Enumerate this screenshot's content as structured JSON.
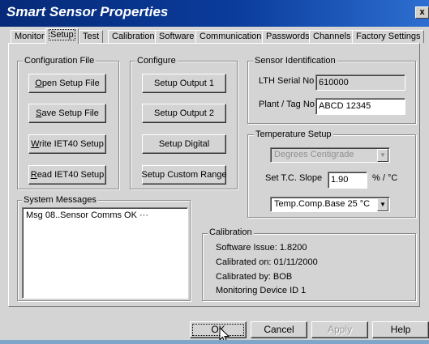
{
  "window": {
    "title": "Smart Sensor Properties",
    "close_glyph": "x"
  },
  "tabs": [
    {
      "label": "Monitor"
    },
    {
      "label": "Setup",
      "active": true
    },
    {
      "label": "Test"
    },
    {
      "label": "Calibration"
    },
    {
      "label": "Software"
    },
    {
      "label": "Communications"
    },
    {
      "label": "Passwords"
    },
    {
      "label": "Channels"
    },
    {
      "label": "Factory Settings"
    }
  ],
  "configuration_file": {
    "legend": "Configuration File",
    "open": "Open Setup File",
    "save": "Save Setup File",
    "write": "Write IET40 Setup",
    "read": "Read IET40 Setup"
  },
  "configure": {
    "legend": "Configure",
    "output1": "Setup Output 1",
    "output2": "Setup Output 2",
    "digital": "Setup Digital",
    "custom_range": "Setup Custom Range"
  },
  "sensor_identification": {
    "legend": "Sensor Identification",
    "serial_label": "LTH Serial No",
    "serial_value": "610000",
    "tag_label": "Plant / Tag No",
    "tag_value": "ABCD 12345"
  },
  "temperature_setup": {
    "legend": "Temperature Setup",
    "units_value": "Degrees Centigrade",
    "slope_label": "Set T.C. Slope",
    "slope_value": "1.90",
    "slope_unit": "% / °C",
    "comp_base_value": "Temp.Comp.Base 25 °C"
  },
  "system_messages": {
    "legend": "System Messages",
    "items": [
      "Msg 08..Sensor Comms OK  ···"
    ]
  },
  "calibration": {
    "legend": "Calibration",
    "software_issue": "Software Issue: 1.8200",
    "calibrated_on": "Calibrated on: 01/11/2000",
    "calibrated_by": "Calibrated by: BOB",
    "monitoring_device": "Monitoring Device ID 1"
  },
  "footer": {
    "ok": "OK",
    "cancel": "Cancel",
    "apply": "Apply",
    "help": "Help"
  }
}
